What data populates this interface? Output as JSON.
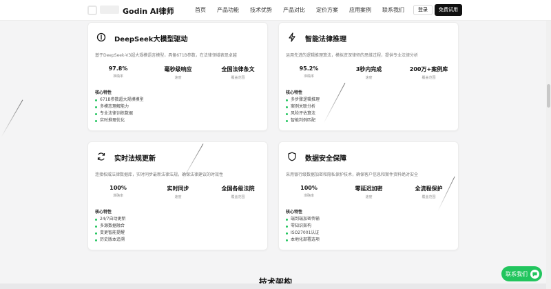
{
  "header": {
    "brand": "Godin AI律师",
    "nav": [
      "首页",
      "产品功能",
      "技术优势",
      "产品对比",
      "定价方案",
      "应用案例",
      "联系我们"
    ],
    "login": "登录",
    "trial": "免费试用"
  },
  "cards": [
    {
      "icon": "brain-icon",
      "title": "DeepSeek大模型驱动",
      "desc": "基于DeepSeek-V3超大规模语言模型，具备671B参数，在法律领域表现卓越",
      "stats": [
        {
          "value": "97.8%",
          "label": "准确率"
        },
        {
          "value": "毫秒级响应",
          "label": "速度"
        },
        {
          "value": "全国法律条文",
          "label": "覆盖范围"
        }
      ],
      "features_title": "核心特性",
      "features": [
        "671B参数超大规模模型",
        "多模态理解能力",
        "专业法律训练数据",
        "实时推理优化"
      ]
    },
    {
      "icon": "lightning-icon",
      "title": "智能法律推理",
      "desc": "运用先进的逻辑推理算法，模拟资深律师的思维过程，提供专业法律分析",
      "stats": [
        {
          "value": "95.2%",
          "label": "准确率"
        },
        {
          "value": "3秒内完成",
          "label": "速度"
        },
        {
          "value": "200万+案例库",
          "label": "覆盖范围"
        }
      ],
      "features_title": "核心特性",
      "features": [
        "多步骤逻辑推理",
        "案例关联分析",
        "风险评估算法",
        "智能判例匹配"
      ]
    },
    {
      "icon": "refresh-icon",
      "title": "实时法规更新",
      "desc": "连接权威法律数据库，实时同步最新法律法规，确保法律建议的时效性",
      "stats": [
        {
          "value": "100%",
          "label": "准确率"
        },
        {
          "value": "实时同步",
          "label": "速度"
        },
        {
          "value": "全国各级法院",
          "label": "覆盖范围"
        }
      ],
      "features_title": "核心特性",
      "features": [
        "24/7自动更新",
        "多源数据融合",
        "变更智能提醒",
        "历史版本追溯"
      ]
    },
    {
      "icon": "shield-icon",
      "title": "数据安全保障",
      "desc": "采用银行级数据加密和隐私保护技术，确保客户信息和案件资料绝对安全",
      "stats": [
        {
          "value": "100%",
          "label": "准确率"
        },
        {
          "value": "零延迟加密",
          "label": "速度"
        },
        {
          "value": "全流程保护",
          "label": "覆盖范围"
        }
      ],
      "features_title": "核心特性",
      "features": [
        "端到端加密传输",
        "零知识架构",
        "ISO27001认证",
        "本地化部署选项"
      ]
    }
  ],
  "section_title": "技术架构",
  "contact_button": "联系我们",
  "colors": {
    "accent": "#22c55e",
    "dark": "#111111"
  }
}
